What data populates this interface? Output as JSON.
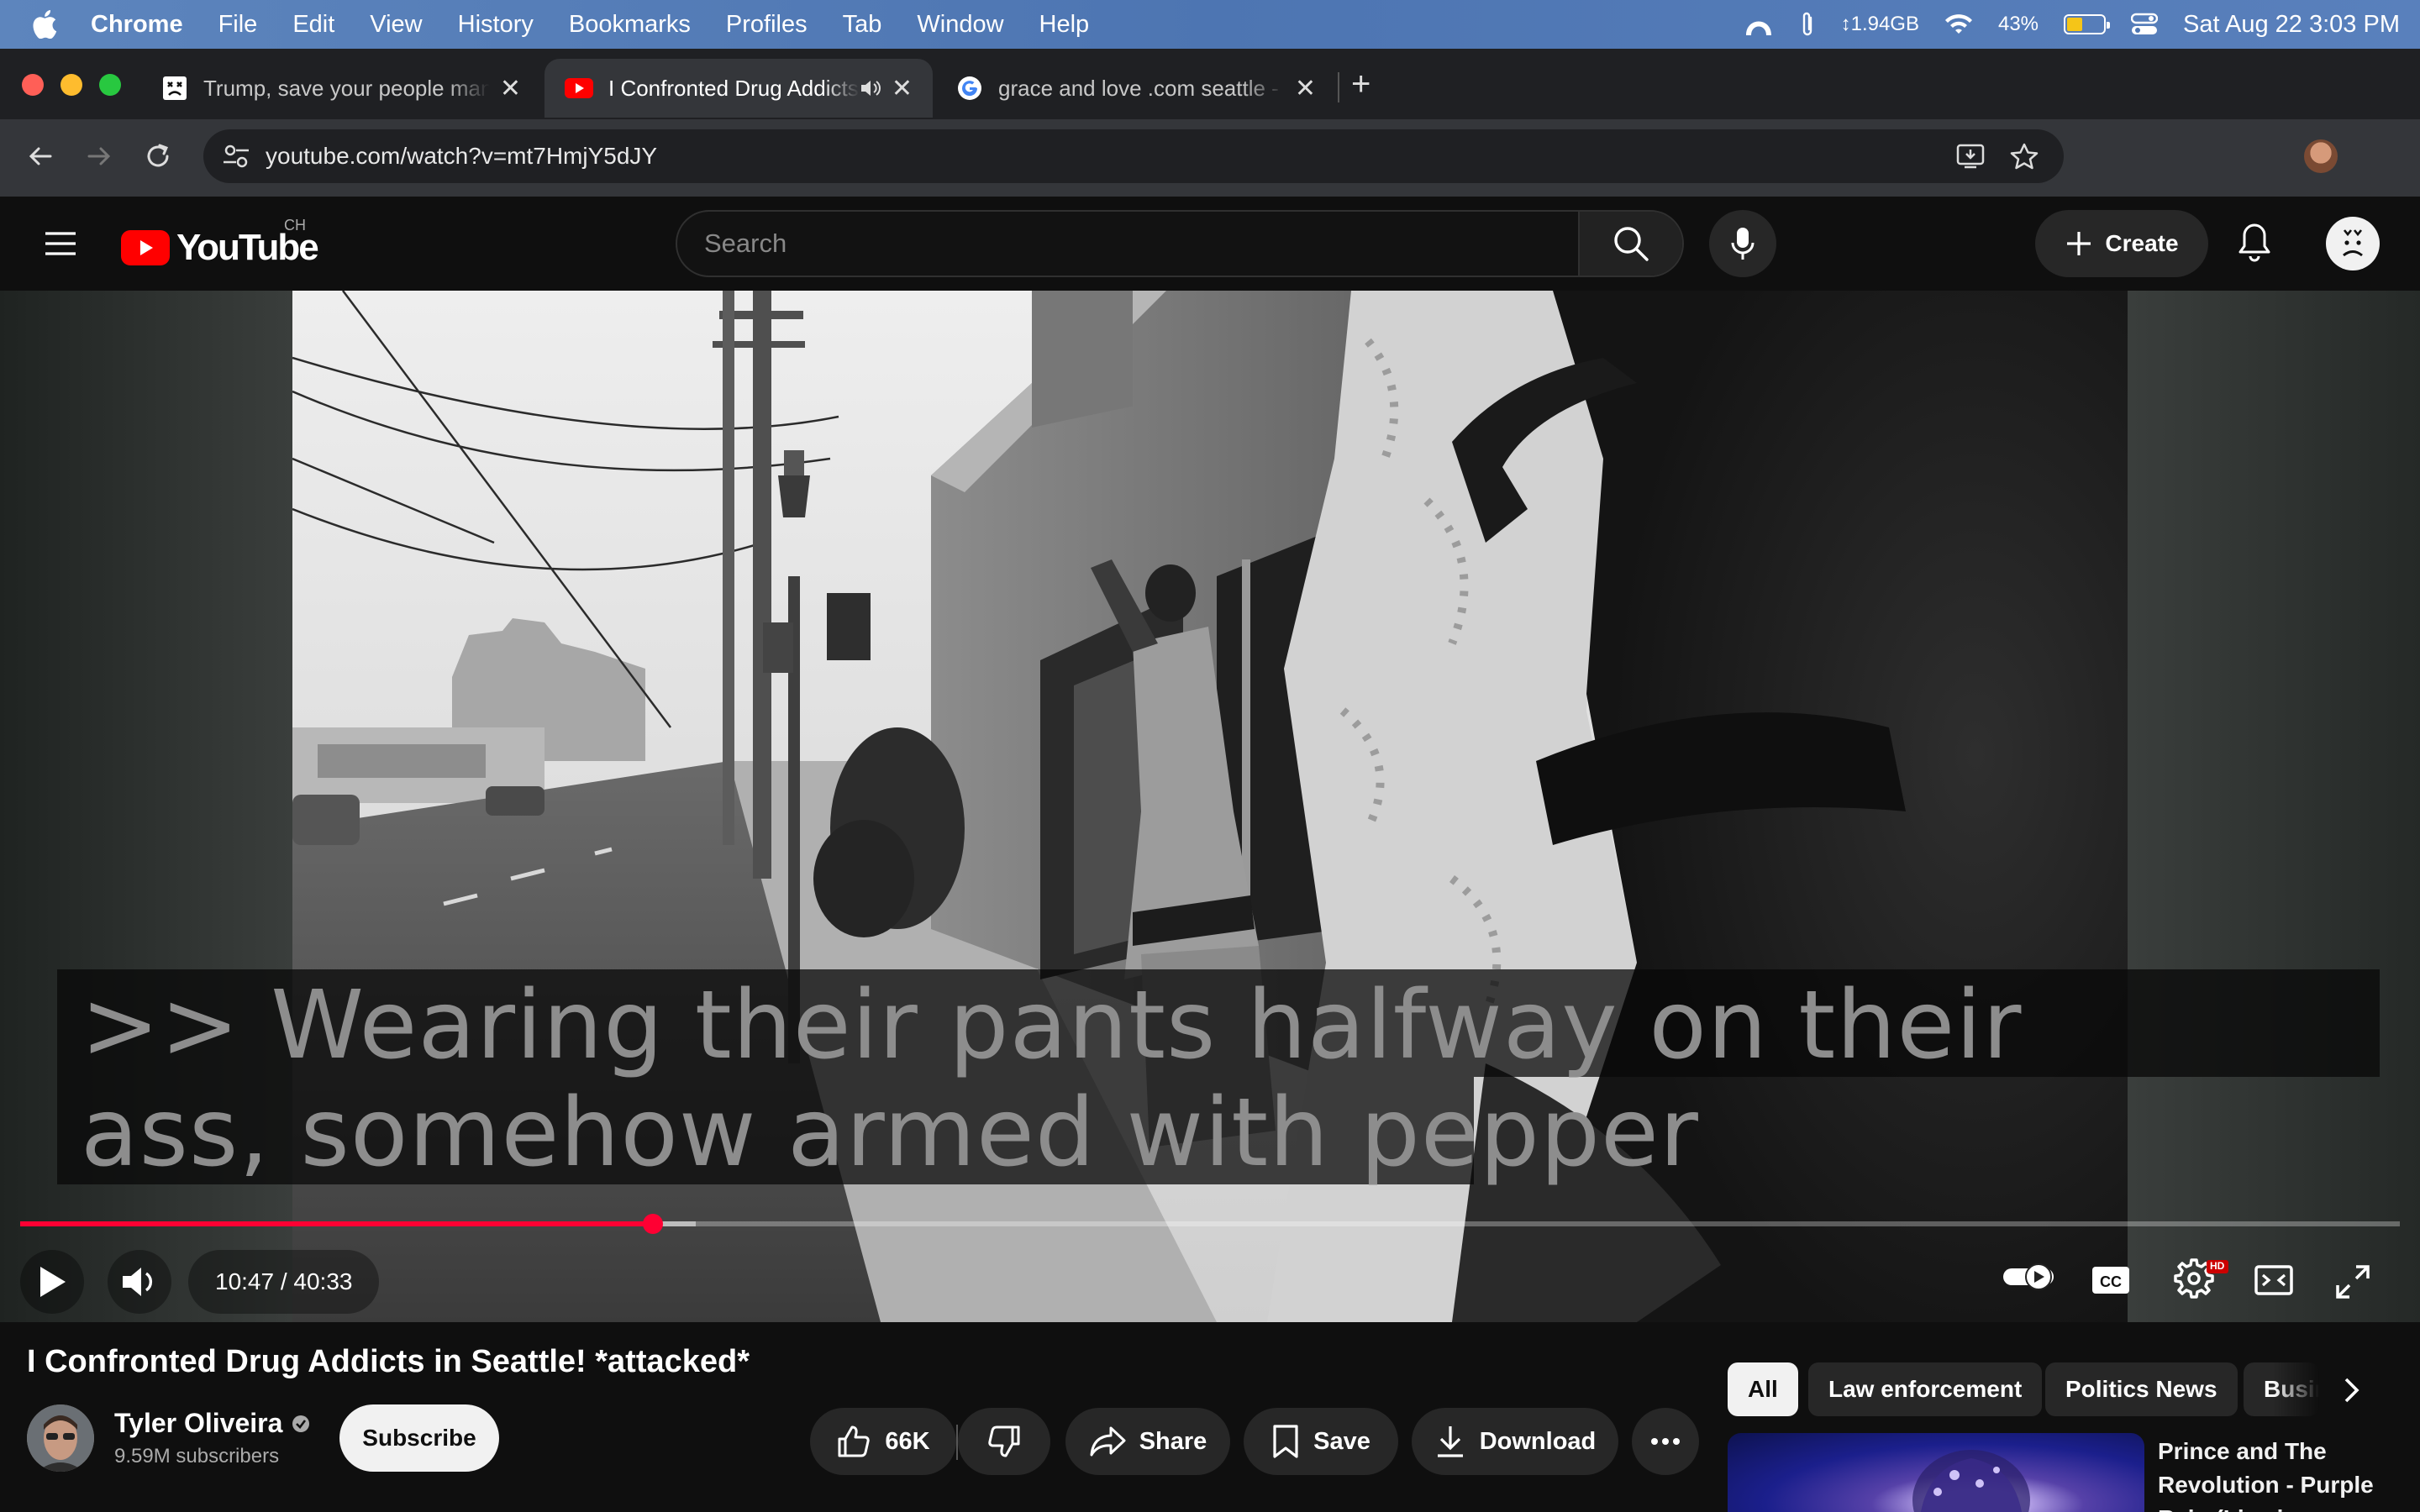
{
  "menubar": {
    "app": "Chrome",
    "items": [
      "File",
      "Edit",
      "View",
      "History",
      "Bookmarks",
      "Profiles",
      "Tab",
      "Window",
      "Help"
    ],
    "memory": "↕1.94GB",
    "battery": "43%",
    "battery_level": 0.43,
    "datetime": "Sat Aug 22  3:03 PM"
  },
  "tabs": [
    {
      "title": "Trump, save your people man",
      "close": "✕"
    },
    {
      "title": "I Confronted Drug Addicts in Seattle",
      "close": "✕"
    },
    {
      "title": "grace and love .com seattle - Google Search",
      "close": "✕"
    }
  ],
  "newtab": "+",
  "toolbar": {
    "url": "youtube.com/watch?v=mt7HmjY5dJY"
  },
  "yt": {
    "logo_text": "YouTube",
    "country": "CH",
    "search_placeholder": "Search",
    "create_label": "Create"
  },
  "player": {
    "caption_line1": ">> Wearing their pants halfway on their",
    "caption_line2": "ass, somehow armed with pepper",
    "time": "10:47 / 40:33",
    "played_fraction": 0.266,
    "buffered_fraction": 0.284,
    "settings_badge": "HD",
    "colors": {
      "progress": "#ff0033"
    }
  },
  "video": {
    "title": "I Confronted Drug Addicts in Seattle! *attacked*",
    "channel": "Tyler Oliveira",
    "subscribers": "9.59M subscribers",
    "subscribe_label": "Subscribe",
    "likes": "66K",
    "share_label": "Share",
    "save_label": "Save",
    "download_label": "Download"
  },
  "chips": [
    "All",
    "Law enforcement",
    "Politics News",
    "Business"
  ],
  "recommendation": {
    "title": "Prince and The Revolution - Purple Rain (Live in Syracuse)"
  }
}
